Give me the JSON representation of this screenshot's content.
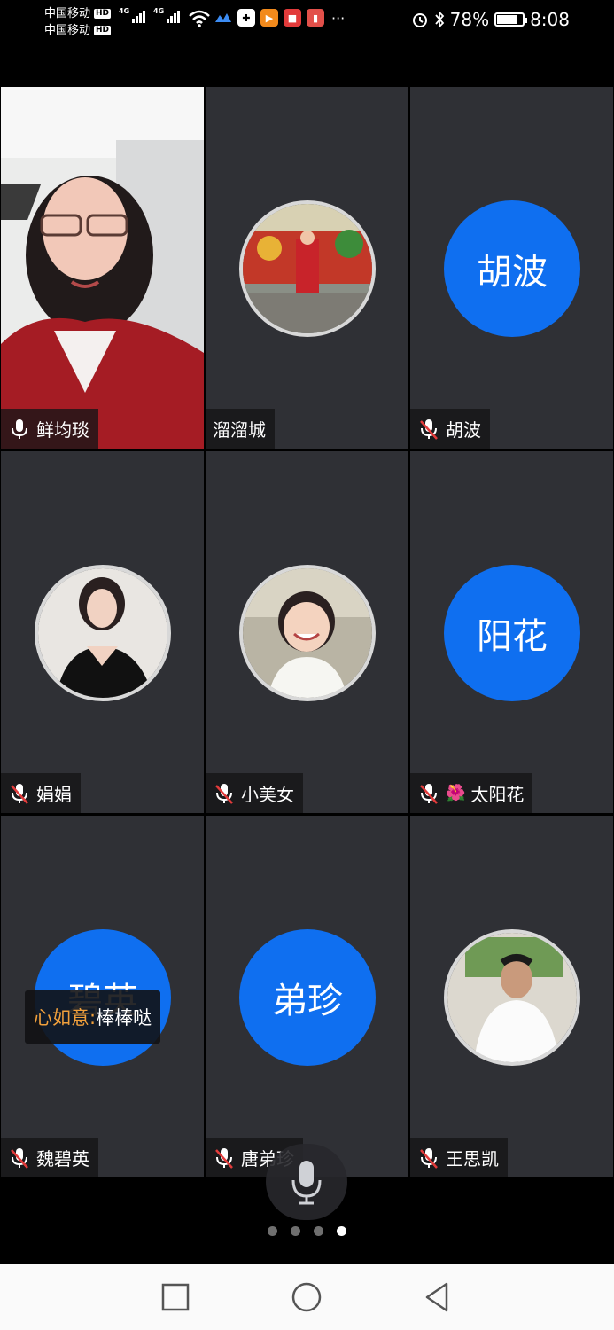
{
  "status_bar": {
    "carrier_1": "中国移动",
    "carrier_2": "中国移动",
    "hd_badge": "HD",
    "network_1": "4G",
    "network_2": "4G",
    "battery_percent": "78%",
    "battery_level": 0.78,
    "time": "8:08",
    "more": "···"
  },
  "participants": [
    {
      "name": "鲜均琰",
      "mic": "on",
      "display": "video"
    },
    {
      "name": "溜溜城",
      "mic": "none",
      "display": "photo"
    },
    {
      "name": "胡波",
      "mic": "muted",
      "display": "initials",
      "initials": "胡波"
    },
    {
      "name": "娟娟",
      "mic": "muted",
      "display": "photo"
    },
    {
      "name": "小美女",
      "mic": "muted",
      "display": "photo"
    },
    {
      "name": "太阳花",
      "mic": "muted",
      "display": "initials",
      "initials": "阳花",
      "emoji": "🌺"
    },
    {
      "name": "魏碧英",
      "mic": "muted",
      "display": "initials",
      "initials": "碧英"
    },
    {
      "name": "唐弟珍",
      "mic": "muted",
      "display": "initials",
      "initials": "弟珍"
    },
    {
      "name": "王思凯",
      "mic": "muted",
      "display": "photo"
    }
  ],
  "caption": {
    "speaker": "心如意:",
    "text": "棒棒哒"
  },
  "pager": {
    "total": 4,
    "active_index": 4
  },
  "colors": {
    "tile_bg": "#2f3035",
    "avatar_blue": "#0f6ff0",
    "caption_speaker": "#f1a03c",
    "mute_red": "#e23b3b"
  }
}
